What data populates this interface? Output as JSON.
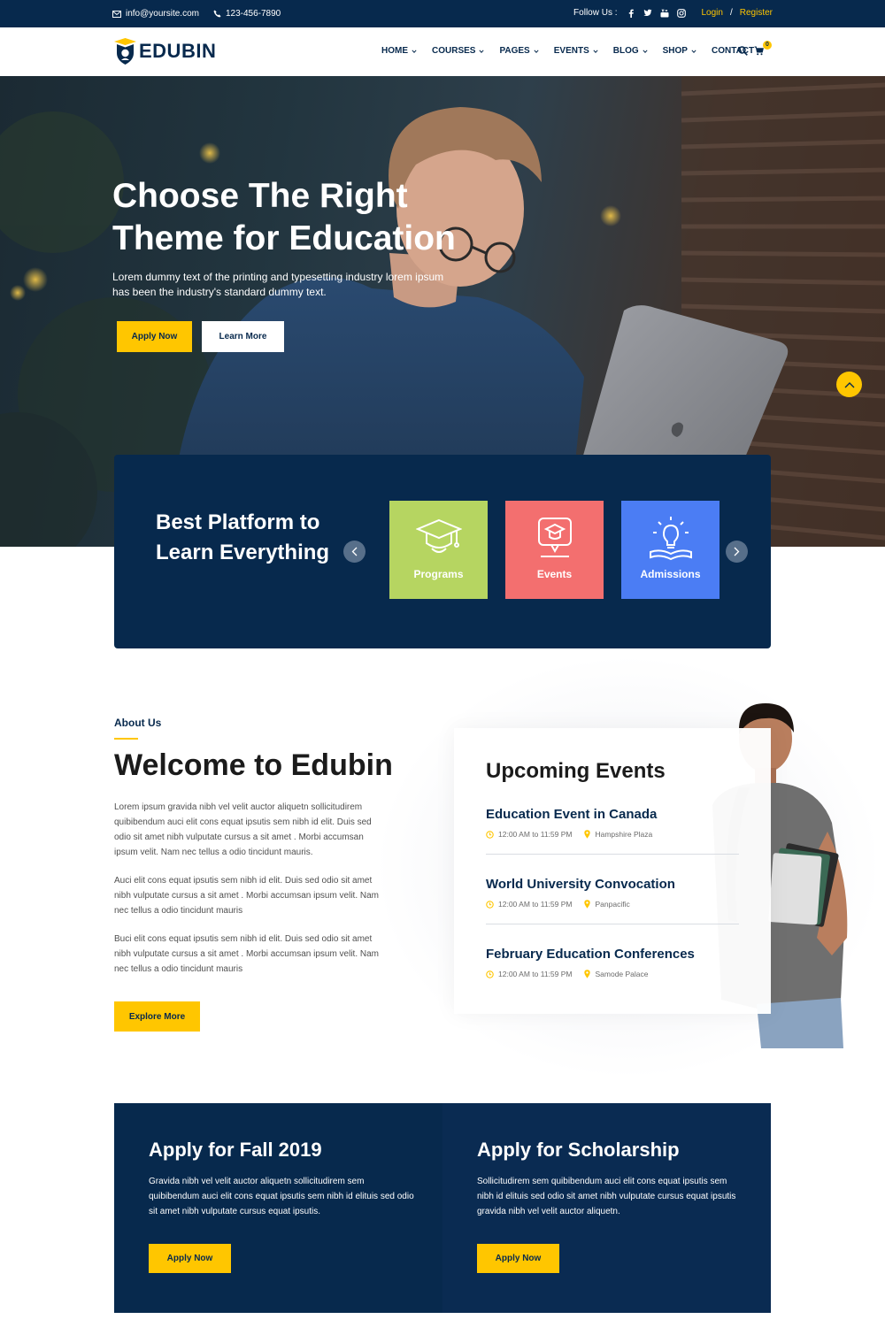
{
  "topbar": {
    "email": "info@yoursite.com",
    "phone": "123-456-7890",
    "follow_label": "Follow Us :",
    "login": "Login",
    "separator": "/",
    "register": "Register",
    "social_icons": [
      "facebook-icon",
      "twitter-icon",
      "youtube-icon",
      "instagram-icon"
    ]
  },
  "header": {
    "logo_text": "EDUBIN",
    "nav": [
      {
        "label": "HOME",
        "has_dropdown": true
      },
      {
        "label": "COURSES",
        "has_dropdown": true
      },
      {
        "label": "PAGES",
        "has_dropdown": true
      },
      {
        "label": "EVENTS",
        "has_dropdown": true
      },
      {
        "label": "BLOG",
        "has_dropdown": true
      },
      {
        "label": "SHOP",
        "has_dropdown": true
      },
      {
        "label": "CONTACT",
        "has_dropdown": false
      }
    ],
    "cart_count": "0"
  },
  "hero": {
    "title": "Choose The Right Theme for Education",
    "text": "Lorem dummy text of the printing and typesetting industry lorem ipsum has been the industry's standard dummy text.",
    "apply_label": "Apply Now",
    "learn_label": "Learn More"
  },
  "platform": {
    "title": "Best Platform to Learn Everything",
    "cards": [
      {
        "label": "Programs",
        "color": "#b6d561",
        "icon": "graduation-cap-icon"
      },
      {
        "label": "Events",
        "color": "#f36f6f",
        "icon": "event-chat-icon"
      },
      {
        "label": "Admissions",
        "color": "#4b7df4",
        "icon": "lightbulb-book-icon"
      }
    ]
  },
  "about": {
    "label": "About Us",
    "title": "Welcome to Edubin",
    "p1": "Lorem ipsum gravida nibh vel velit auctor aliquetn sollicitudirem quibibendum auci elit cons equat ipsutis sem nibh id elit. Duis sed odio sit amet nibh vulputate cursus a sit amet . Morbi accumsan ipsum velit. Nam nec tellus a odio tincidunt mauris.",
    "p2": "Auci elit cons equat ipsutis sem nibh id elit. Duis sed odio sit amet nibh vulputate cursus a sit amet . Morbi accumsan ipsum velit. Nam nec tellus a odio tincidunt mauris",
    "p3": "Buci elit cons equat ipsutis sem nibh id elit. Duis sed odio sit amet nibh vulputate cursus a sit amet . Morbi accumsan ipsum velit. Nam nec tellus a odio tincidunt mauris",
    "button": "Explore More"
  },
  "events": {
    "title": "Upcoming Events",
    "items": [
      {
        "title": "Education Event in Canada",
        "time": "12:00 AM to 11:59 PM",
        "place": "Hampshire Plaza"
      },
      {
        "title": "World University Convocation",
        "time": "12:00 AM to 11:59 PM",
        "place": "Panpacific"
      },
      {
        "title": "February Education Conferences",
        "time": "12:00 AM to 11:59 PM",
        "place": "Samode Palace"
      }
    ]
  },
  "apply": {
    "col1": {
      "title": "Apply for Fall 2019",
      "text": "Gravida nibh vel velit auctor aliquetn sollicitudirem sem quibibendum auci elit cons equat ipsutis sem nibh id elituis sed odio sit amet nibh vulputate cursus equat ipsutis.",
      "button": "Apply Now"
    },
    "col2": {
      "title": "Apply for Scholarship",
      "text": "Sollicitudirem sem quibibendum auci elit cons equat ipsutis sem nibh id elituis sed odio sit amet nibh vulputate cursus equat ipsutis gravida nibh vel velit auctor aliquetn.",
      "button": "Apply Now"
    }
  },
  "colors": {
    "navy": "#07294d",
    "yellow": "#ffc600",
    "programs": "#b6d561",
    "events": "#f36f6f",
    "admissions": "#4b7df4"
  }
}
